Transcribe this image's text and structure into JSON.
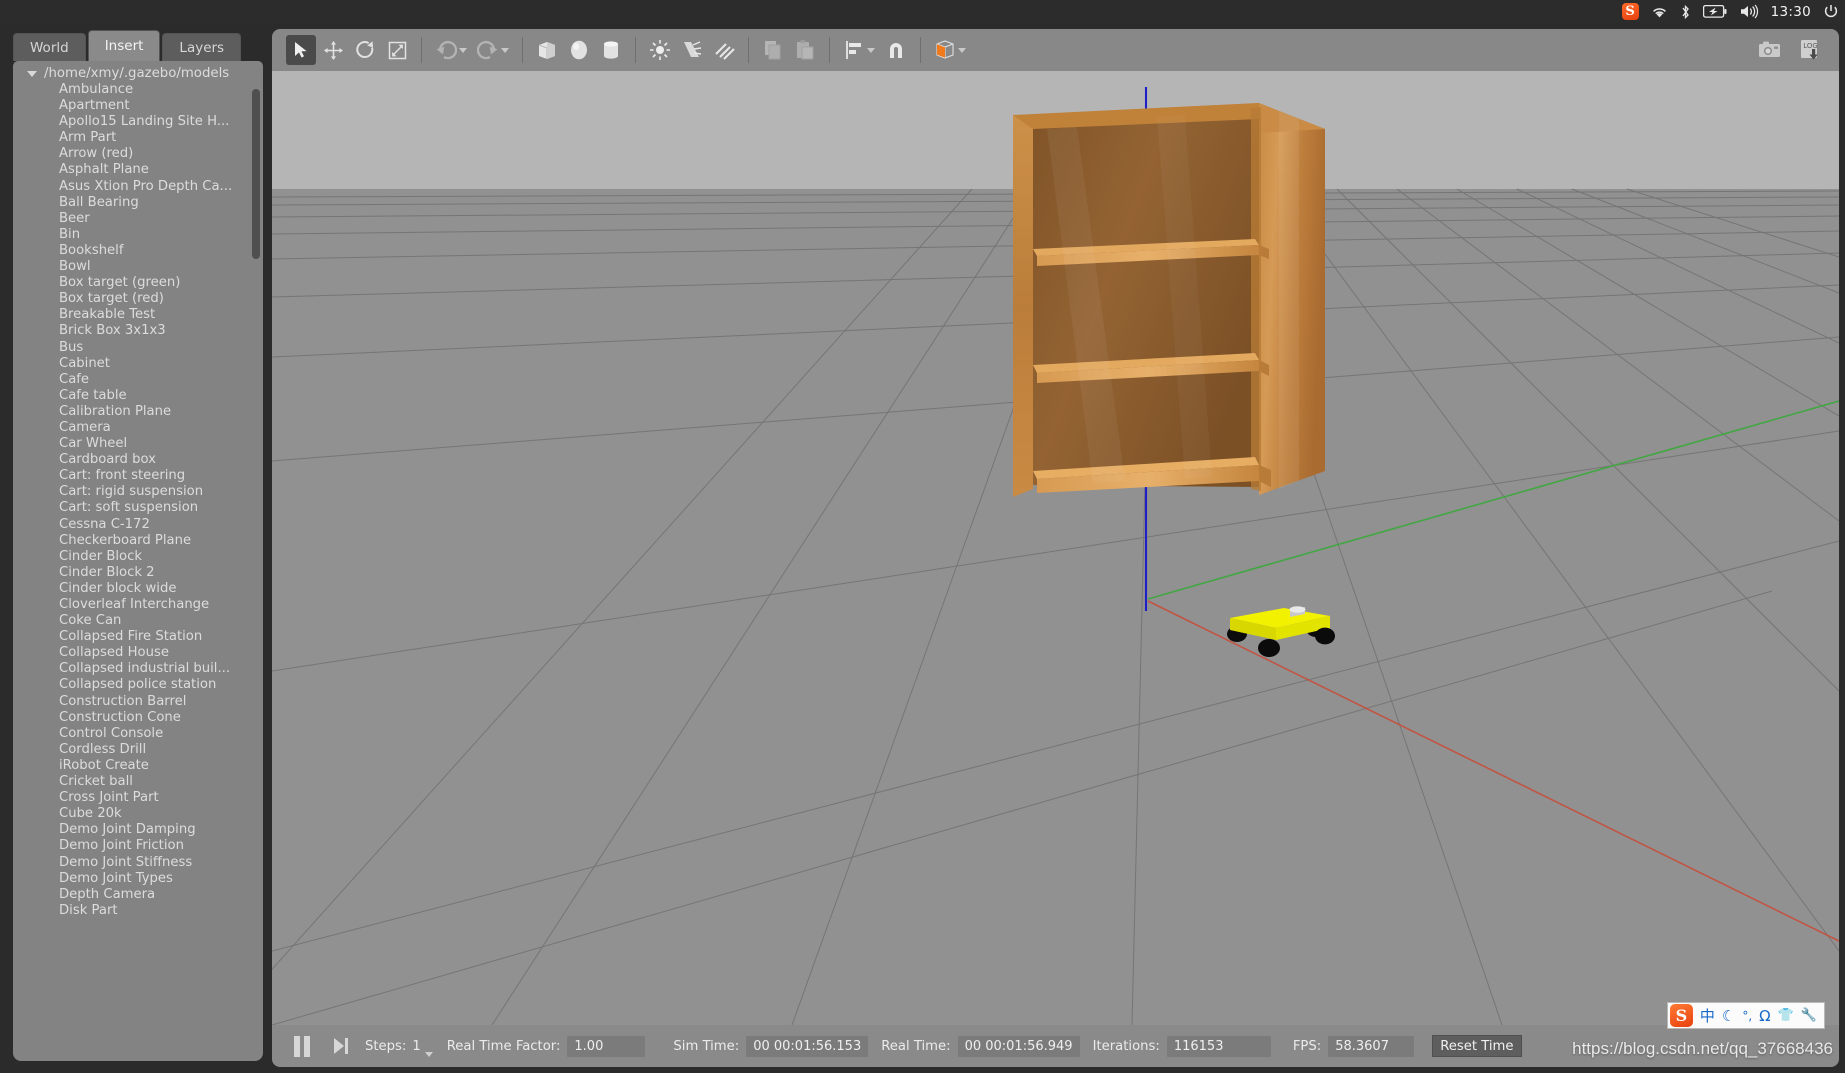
{
  "system_bar": {
    "time": "13:30",
    "icons": [
      "sogou-ime-icon",
      "wifi-icon",
      "bluetooth-icon",
      "battery-icon",
      "volume-icon",
      "power-gear-icon"
    ]
  },
  "left_panel": {
    "tabs": [
      {
        "label": "World",
        "active": false
      },
      {
        "label": "Insert",
        "active": true
      },
      {
        "label": "Layers",
        "active": false
      }
    ],
    "tree_root": "/home/xmy/.gazebo/models",
    "models": [
      "Ambulance",
      "Apartment",
      "Apollo15 Landing Site H...",
      "Arm Part",
      "Arrow (red)",
      "Asphalt Plane",
      "Asus Xtion Pro Depth Ca...",
      "Ball Bearing",
      "Beer",
      "Bin",
      "Bookshelf",
      "Bowl",
      "Box target (green)",
      "Box target (red)",
      "Breakable Test",
      "Brick Box 3x1x3",
      "Bus",
      "Cabinet",
      "Cafe",
      "Cafe table",
      "Calibration Plane",
      "Camera",
      "Car Wheel",
      "Cardboard box",
      "Cart: front steering",
      "Cart: rigid suspension",
      "Cart: soft suspension",
      "Cessna C-172",
      "Checkerboard Plane",
      "Cinder Block",
      "Cinder Block 2",
      "Cinder block wide",
      "Cloverleaf Interchange",
      "Coke Can",
      "Collapsed Fire Station",
      "Collapsed House",
      "Collapsed industrial buil...",
      "Collapsed police station",
      "Construction Barrel",
      "Construction Cone",
      "Control Console",
      "Cordless Drill",
      "iRobot Create",
      "Cricket ball",
      "Cross Joint Part",
      "Cube 20k",
      "Demo Joint Damping",
      "Demo Joint Friction",
      "Demo Joint Stiffness",
      "Demo Joint Types",
      "Depth Camera",
      "Disk Part"
    ]
  },
  "toolbar": {
    "tools": [
      {
        "name": "select-arrow-tool",
        "selected": true
      },
      {
        "name": "translate-tool",
        "selected": false
      },
      {
        "name": "rotate-tool",
        "selected": false
      },
      {
        "name": "scale-tool",
        "selected": false
      },
      {
        "name": "undo-tool",
        "selected": false
      },
      {
        "name": "redo-tool",
        "selected": false
      },
      {
        "name": "insert-box-tool",
        "selected": false
      },
      {
        "name": "insert-sphere-tool",
        "selected": false
      },
      {
        "name": "insert-cylinder-tool",
        "selected": false
      },
      {
        "name": "point-light-tool",
        "selected": false
      },
      {
        "name": "spot-light-tool",
        "selected": false
      },
      {
        "name": "directional-light-tool",
        "selected": false
      },
      {
        "name": "copy-tool",
        "selected": false
      },
      {
        "name": "paste-tool",
        "selected": false
      },
      {
        "name": "align-tool",
        "selected": false
      },
      {
        "name": "snap-tool",
        "selected": false
      },
      {
        "name": "view-cube-tool",
        "selected": false
      }
    ],
    "right_icons": [
      "screenshot-camera-icon",
      "log-download-icon"
    ]
  },
  "scene": {
    "sky_color": "#b5b5b5",
    "ground_color": "#919191",
    "objects": [
      {
        "name": "bookshelf-model",
        "color": "#c1803c"
      },
      {
        "name": "robot-chassis",
        "color": "#ecec00"
      },
      {
        "name": "robot-wheel",
        "color": "#0d0d0d"
      },
      {
        "name": "robot-sensor",
        "color": "#dcdcdc"
      }
    ],
    "axes": {
      "x_axis_color": "#d9503c",
      "y_axis_color": "#3aae3a",
      "z_axis_color": "#1f1fc8"
    }
  },
  "status_bar": {
    "pause_label": "pause-button",
    "step_forward_label": "step-forward-button",
    "steps_label": "Steps:",
    "steps_value": "1",
    "real_time_factor_label": "Real Time Factor:",
    "real_time_factor_value": "1.00",
    "sim_time_label": "Sim Time:",
    "sim_time_value": "00 00:01:56.153",
    "real_time_label": "Real Time:",
    "real_time_value": "00 00:01:56.949",
    "iterations_label": "Iterations:",
    "iterations_value": "116153",
    "fps_label": "FPS:",
    "fps_value": "58.3607",
    "reset_time_label": "Reset Time"
  },
  "watermark": "https://blog.csdn.net/qq_37668436",
  "sogou_bar": {
    "items": [
      "S",
      "中",
      "☾",
      "°,",
      "Ω",
      "👕",
      "🔧"
    ]
  }
}
